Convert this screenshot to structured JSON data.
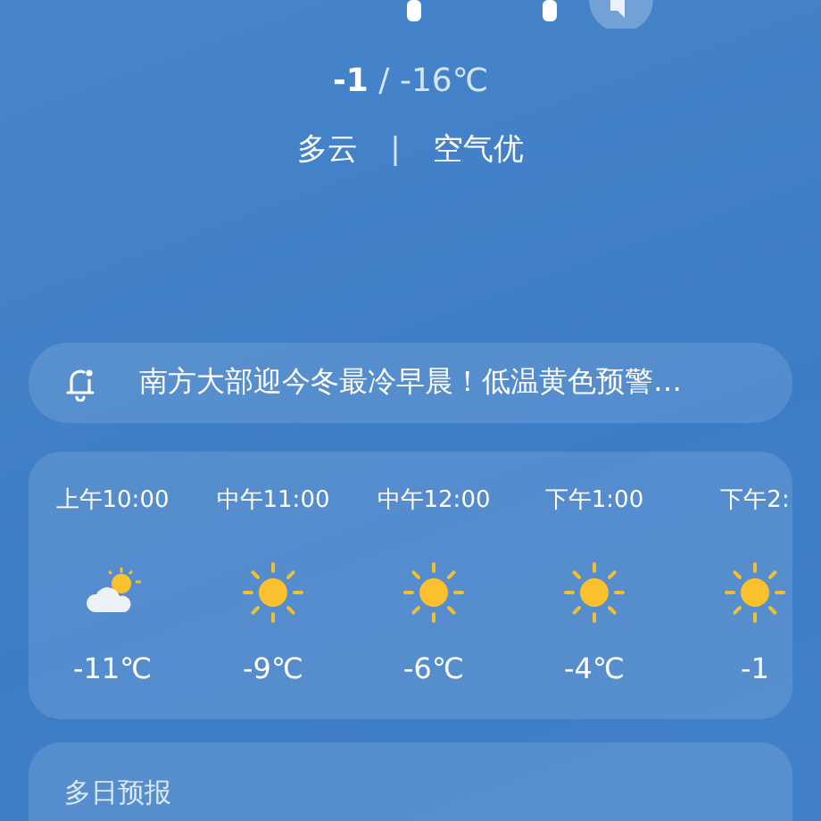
{
  "current": {
    "high": "-1",
    "low": " / -16℃",
    "condition": "多云",
    "separator": "|",
    "air_quality": "空气优"
  },
  "alert": {
    "text": "南方大部迎今冬最冷早晨！低温黄色预警…"
  },
  "hourly": [
    {
      "time": "上午10:00",
      "kind": "partly-cloudy",
      "temp": "-11℃"
    },
    {
      "time": "中午11:00",
      "kind": "sunny",
      "temp": "-9℃"
    },
    {
      "time": "中午12:00",
      "kind": "sunny",
      "temp": "-6℃"
    },
    {
      "time": "下午1:00",
      "kind": "sunny",
      "temp": "-4℃"
    },
    {
      "time": "下午2:",
      "kind": "sunny",
      "temp": "-1"
    }
  ],
  "forecast": {
    "title": "多日预报"
  }
}
